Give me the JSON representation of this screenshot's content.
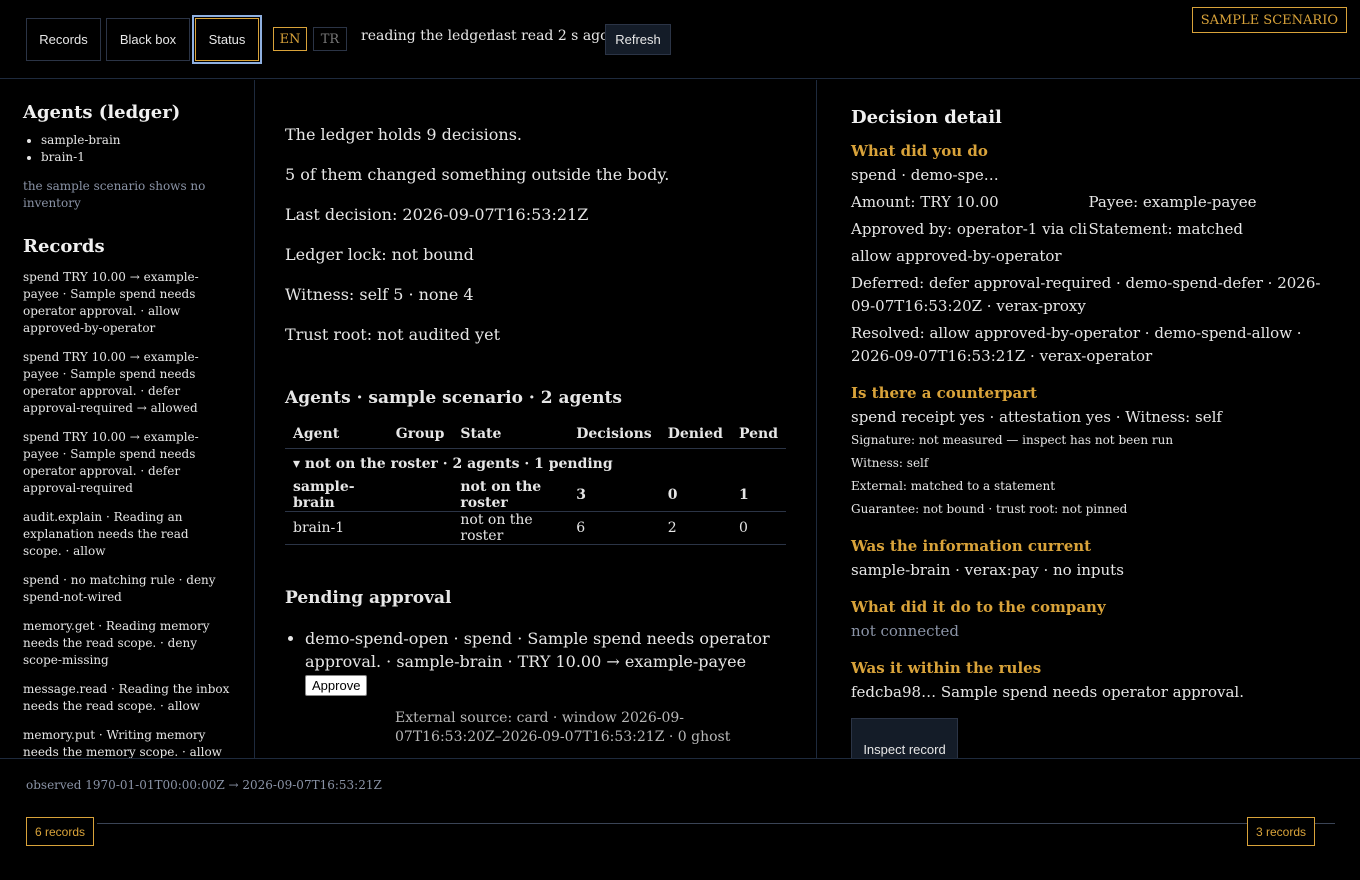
{
  "header": {
    "tabs": [
      {
        "label": "Records",
        "active": false
      },
      {
        "label": "Black box",
        "active": false
      },
      {
        "label": "Status",
        "active": true
      }
    ],
    "languages": [
      {
        "label": "EN",
        "active": true
      },
      {
        "label": "TR",
        "active": false
      }
    ],
    "status_text": "reading the ledger",
    "last_read": "last read 2 s ago",
    "refresh_label": "Refresh",
    "scenario_badge": "SAMPLE SCENARIO"
  },
  "sidebar": {
    "agents_title": "Agents (ledger)",
    "agents": [
      "sample-brain",
      "brain-1"
    ],
    "inventory_note": "the sample scenario shows no inventory",
    "records_title": "Records",
    "records": [
      "spend TRY 10.00 → example-payee · Sample spend needs operator approval. · allow approved-by-operator",
      "spend TRY 10.00 → example-payee · Sample spend needs operator approval. · defer approval-required → allowed",
      "spend TRY 10.00 → example-payee · Sample spend needs operator approval. · defer approval-required",
      "audit.explain · Reading an explanation needs the read scope. · allow",
      "spend · no matching rule · deny spend-not-wired",
      "memory.get · Reading memory needs the read scope. · deny scope-missing",
      "message.read · Reading the inbox needs the read scope. · allow",
      "memory.put · Writing memory needs the memory scope. · allow"
    ]
  },
  "main": {
    "stats": [
      "The ledger holds 9 decisions.",
      "5 of them changed something outside the body.",
      "Last decision: 2026-09-07T16:53:21Z",
      "Ledger lock: not bound",
      "Witness: self 5 · none 4",
      "Trust root: not audited yet"
    ],
    "agents_title": "Agents · sample scenario · 2 agents",
    "columns": [
      "Agent",
      "Group",
      "State",
      "Decisions",
      "Denied",
      "Pend"
    ],
    "group_row": "▾  not on the roster · 2 agents · 1 pending",
    "rows": [
      {
        "agent": "sample-brain",
        "group": "",
        "state": "not on the roster",
        "decisions": "3",
        "denied": "0",
        "pending": "1"
      },
      {
        "agent": "brain-1",
        "group": "",
        "state": "not on the roster",
        "decisions": "6",
        "denied": "2",
        "pending": "0"
      }
    ],
    "pending_title": "Pending approval",
    "pending_item": "demo-spend-open · spend · Sample spend needs operator approval. · sample-brain · TRY 10.00 → example-payee",
    "approve_label": "Approve",
    "external_source": "External source: card · window 2026-09-07T16:53:20Z–2026-09-07T16:53:21Z · 0 ghost"
  },
  "detail": {
    "title": "Decision detail",
    "q_what": "What did you do",
    "what_line": "spend · demo-spe…",
    "amount": "Amount: TRY 10.00",
    "payee": "Payee: example-payee",
    "approved_by": "Approved by: operator-1 via cli",
    "statement": "Statement: matched",
    "verdict": "allow approved-by-operator",
    "deferred": "Deferred: defer approval-required · demo-spend-defer · 2026-09-07T16:53:20Z · verax-proxy",
    "resolved": "Resolved: allow approved-by-operator · demo-spend-allow · 2026-09-07T16:53:21Z · verax-operator",
    "q_counterpart": "Is there a counterpart",
    "counterpart_line": "spend receipt yes · attestation yes · Witness: self",
    "signature": "Signature: not measured — inspect has not been run",
    "witness": "Witness: self",
    "external": "External: matched to a statement",
    "guarantee": "Guarantee: not bound · trust root: not pinned",
    "q_current": "Was the information current",
    "current_line": "sample-brain · verax:pay · no inputs",
    "q_company": "What did it do to the company",
    "company_line": "not connected",
    "q_rules": "Was it within the rules",
    "rules_line": "fedcba98… Sample spend needs operator approval.",
    "inspect_label": "Inspect record"
  },
  "footer": {
    "observed": "observed 1970-01-01T00:00:00Z → 2026-09-07T16:53:21Z",
    "left_records": "6 records",
    "right_records": "3 records"
  },
  "colors": {
    "accent": "#d9a33a",
    "border": "#1e2a3d",
    "muted": "#8a93a6",
    "focus": "#8fb0e0"
  }
}
